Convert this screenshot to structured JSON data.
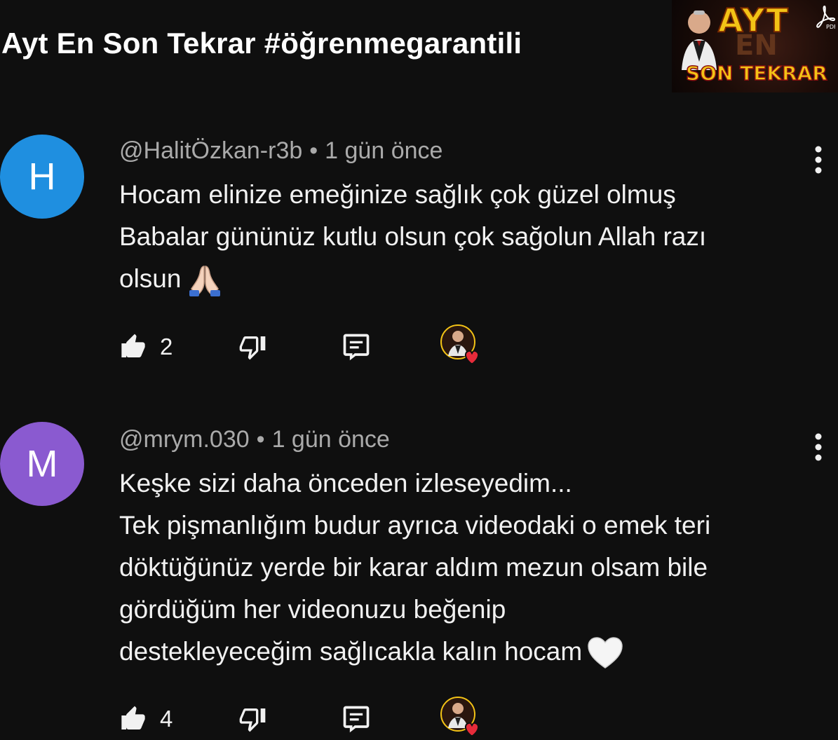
{
  "video": {
    "title": "Ayt En Son Tekrar #öğrenmegarantili",
    "thumbnail": {
      "line1": "AYT",
      "line2": "EN",
      "line3": "SON TEKRAR",
      "badge_icon": "pdf-icon"
    }
  },
  "colors": {
    "background": "#0f0f0f",
    "text_primary": "#f1f1f1",
    "text_secondary": "#aaaaaa",
    "avatar_h": "#1f8fe0",
    "avatar_m": "#8a5ad0",
    "heart": "#e62b3a"
  },
  "comments": [
    {
      "avatar_letter": "H",
      "author": "@HalitÖzkan-r3b",
      "separator": "•",
      "time": "1 gün önce",
      "lines": [
        "Hocam elinize emeğinize sağlık çok güzel olmuş",
        "Babalar gününüz kutlu olsun çok sağolun Allah razı",
        "olsun"
      ],
      "end_emoji": "folded-hands-emoji",
      "likes": "2",
      "icons": [
        "like-icon",
        "dislike-icon",
        "reply-icon",
        "creator-heart-icon"
      ]
    },
    {
      "avatar_letter": "M",
      "author": "@mrym.030",
      "separator": "•",
      "time": "1 gün önce",
      "lines": [
        "Keşke sizi daha önceden izleseyedim...",
        "Tek pişmanlığım budur ayrıca videodaki o emek teri",
        "döktüğünüz yerde bir karar aldım mezun olsam bile",
        "gördüğüm her videonuzu beğenip",
        "destekleyeceğim sağlıcakla kalın hocam"
      ],
      "end_emoji": "white-heart-emoji",
      "likes": "4",
      "icons": [
        "like-icon",
        "dislike-icon",
        "reply-icon",
        "creator-heart-icon"
      ]
    }
  ]
}
